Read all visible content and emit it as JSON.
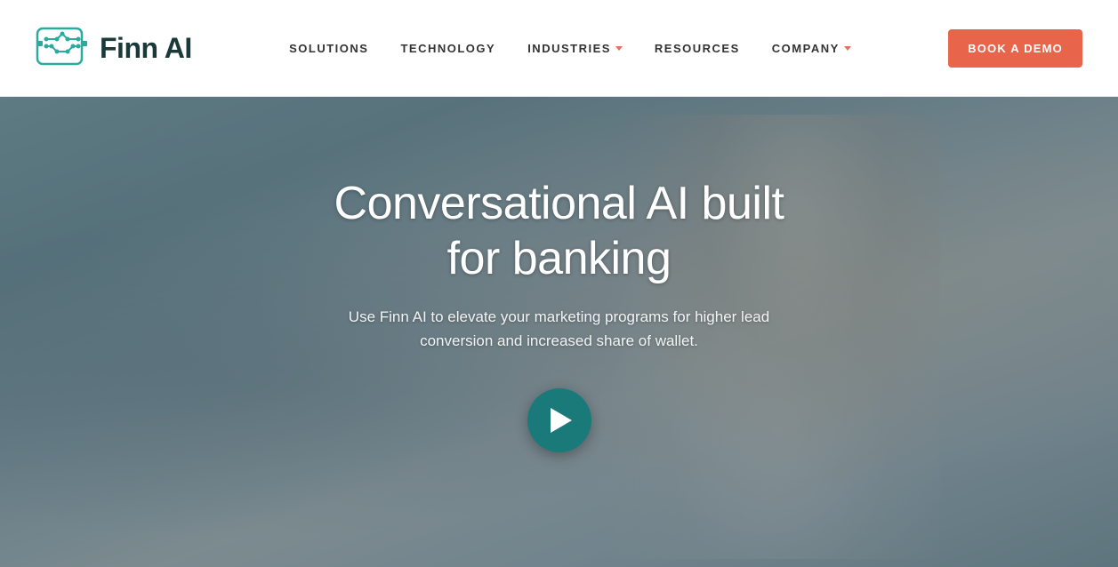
{
  "header": {
    "logo_text": "Finn AI",
    "nav_items": [
      {
        "label": "SOLUTIONS",
        "has_dropdown": false
      },
      {
        "label": "TECHNOLOGY",
        "has_dropdown": false
      },
      {
        "label": "INDUSTRIES",
        "has_dropdown": true
      },
      {
        "label": "RESOURCES",
        "has_dropdown": false
      },
      {
        "label": "COMPANY",
        "has_dropdown": true
      }
    ],
    "cta_button": "BOOK A DEMO"
  },
  "hero": {
    "title": "Conversational AI built\nfor banking",
    "subtitle": "Use Finn AI to elevate your marketing programs for higher lead conversion and increased share of wallet.",
    "play_button_label": "Play video"
  },
  "colors": {
    "teal_dark": "#1a3a3a",
    "teal_accent": "#1a7a7a",
    "orange_cta": "#e8644a",
    "dropdown_arrow": "#e07060"
  }
}
